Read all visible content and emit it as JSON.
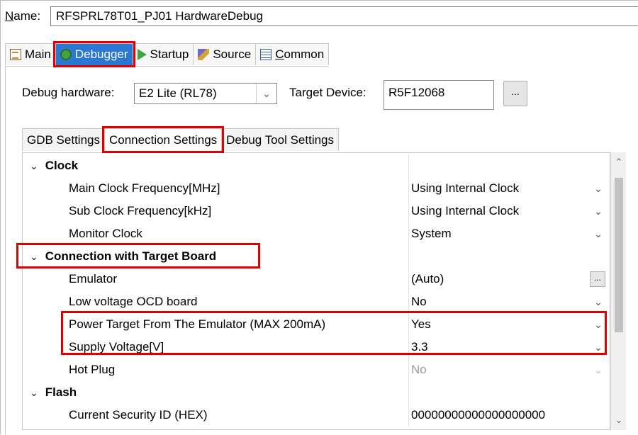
{
  "name_row": {
    "label_u": "N",
    "label_rest": "ame:",
    "value": "RFSPRL78T01_PJ01 HardwareDebug"
  },
  "top_tabs": [
    {
      "label": "Main",
      "icon": "main-tab-icon"
    },
    {
      "label": "Debugger",
      "icon": "bug-icon"
    },
    {
      "label": "Startup",
      "icon": "play-icon"
    },
    {
      "label": "Source",
      "icon": "source-icon"
    },
    {
      "label_u": "C",
      "label_rest": "ommon",
      "icon": "common-icon"
    }
  ],
  "debug_hardware": {
    "label": "Debug hardware:",
    "value": "E2 Lite (RL78)"
  },
  "target_device": {
    "label": "Target Device:",
    "value": "R5F12068",
    "browse": "..."
  },
  "sub_tabs": [
    "GDB Settings",
    "Connection Settings",
    "Debug Tool Settings"
  ],
  "table": {
    "clock": {
      "label": "Clock",
      "rows": [
        {
          "name": "Main Clock Frequency[MHz]",
          "value": "Using Internal Clock"
        },
        {
          "name": "Sub Clock Frequency[kHz]",
          "value": "Using Internal Clock"
        },
        {
          "name": "Monitor Clock",
          "value": "System"
        }
      ]
    },
    "connection": {
      "label": "Connection with Target Board",
      "rows": [
        {
          "name": "Emulator",
          "value": "(Auto)",
          "button": "..."
        },
        {
          "name": "Low voltage OCD board",
          "value": "No"
        },
        {
          "name": "Power Target From The Emulator (MAX 200mA)",
          "value": "Yes"
        },
        {
          "name": "Supply Voltage[V]",
          "value": "3.3"
        },
        {
          "name": "Hot Plug",
          "value": "No"
        }
      ]
    },
    "flash": {
      "label": "Flash",
      "rows": [
        {
          "name": "Current Security ID (HEX)",
          "value": "00000000000000000000"
        }
      ]
    }
  },
  "colors": {
    "active_tab": "#2a78d4",
    "highlight": "#e00000"
  }
}
